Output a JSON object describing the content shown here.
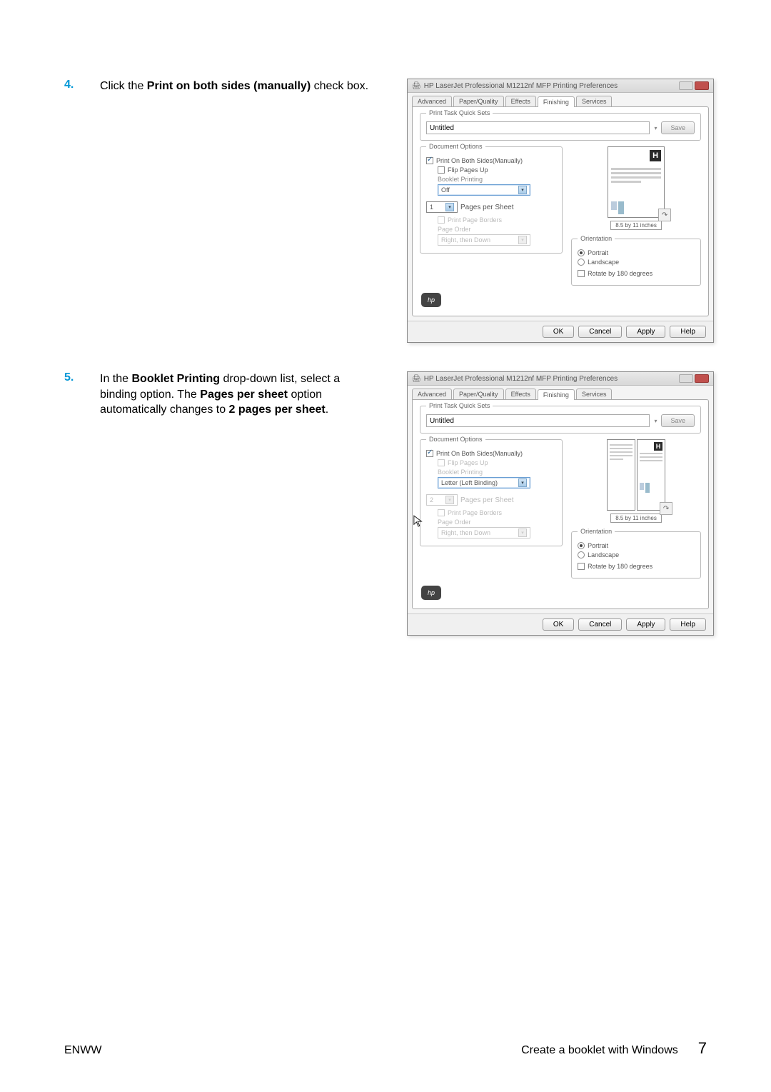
{
  "steps": {
    "s4": {
      "num": "4.",
      "text_a": "Click the ",
      "text_b": "Print on both sides (manually)",
      "text_c": " check box."
    },
    "s5": {
      "num": "5.",
      "text_a": "In the ",
      "text_b": "Booklet Printing",
      "text_c": " drop-down list, select a binding option. The ",
      "text_d": "Pages per sheet",
      "text_e": " option automatically changes to ",
      "text_f": "2 pages per sheet",
      "text_g": "."
    }
  },
  "dialog1": {
    "title": "HP LaserJet Professional M1212nf MFP Printing Preferences",
    "tabs": [
      "Advanced",
      "Paper/Quality",
      "Effects",
      "Finishing",
      "Services"
    ],
    "active_tab": "Finishing",
    "quickset_legend": "Print Task Quick Sets",
    "quickset_value": "Untitled",
    "save_label": "Save",
    "doc_options_legend": "Document Options",
    "print_both": "Print On Both Sides(Manually)",
    "flip_up": "Flip Pages Up",
    "booklet_label": "Booklet Printing",
    "booklet_value": "Off",
    "pages_per_value": "1",
    "pages_per_label": "Pages per Sheet",
    "print_borders": "Print Page Borders",
    "page_order_label": "Page Order",
    "page_order_value": "Right, then Down",
    "orientation_legend": "Orientation",
    "portrait": "Portrait",
    "landscape": "Landscape",
    "rotate": "Rotate by 180 degrees",
    "preview_dim": "8.5 by 11 inches",
    "buttons": [
      "OK",
      "Cancel",
      "Apply",
      "Help"
    ]
  },
  "dialog2": {
    "title": "HP LaserJet Professional M1212nf MFP Printing Preferences",
    "tabs": [
      "Advanced",
      "Paper/Quality",
      "Effects",
      "Finishing",
      "Services"
    ],
    "active_tab": "Finishing",
    "quickset_legend": "Print Task Quick Sets",
    "quickset_value": "Untitled",
    "save_label": "Save",
    "doc_options_legend": "Document Options",
    "print_both": "Print On Both Sides(Manually)",
    "flip_up": "Flip Pages Up",
    "booklet_label": "Booklet Printing",
    "booklet_value": "Letter (Left Binding)",
    "pages_per_value": "2",
    "pages_per_label": "Pages per Sheet",
    "print_borders": "Print Page Borders",
    "page_order_label": "Page Order",
    "page_order_value": "Right, then Down",
    "orientation_legend": "Orientation",
    "portrait": "Portrait",
    "landscape": "Landscape",
    "rotate": "Rotate by 180 degrees",
    "preview_dim": "8.5 by 11 inches",
    "buttons": [
      "OK",
      "Cancel",
      "Apply",
      "Help"
    ]
  },
  "footer": {
    "left": "ENWW",
    "right": "Create a booklet with Windows",
    "page": "7"
  },
  "icons": {
    "hp": "hp"
  }
}
